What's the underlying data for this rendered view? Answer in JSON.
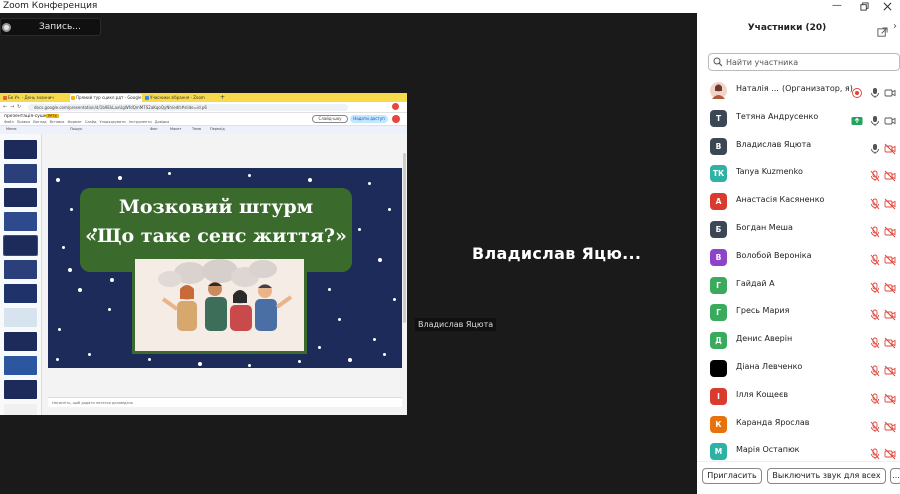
{
  "window": {
    "title": "Zoom Конференция",
    "minimize_label": "—"
  },
  "recording": {
    "label": "Запись..."
  },
  "screenshare": {
    "tabs": [
      {
        "label": "Бе Уч. - День знаннич вардів і",
        "fav": "#e35d3a"
      },
      {
        "label": "Прямий тур сцикл.рдт - Google",
        "fav": "#f4b400"
      },
      {
        "label": "Учасники зібрання - Zoom",
        "fav": "#2d8cff"
      }
    ],
    "url": "docs.google.com/presentation/d/1b9EkLaxUgWfdQmM7S2aKqoQyNh/edit#slide=id.p6",
    "doc_title": "презентація-сушка",
    "doc_badge": "PPTX",
    "menu": "Файл  Правка  Вигляд  Вставка  Формат  Слайд  Упорядкувати  Інструменти  Довідка",
    "slideshow_label": "Слайд-шоу",
    "share_label": "Надати доступ",
    "toolbar_items": [
      "Меню",
      "Пошук",
      "Фон",
      "Макет",
      "Тема",
      "Перехід"
    ],
    "notes_placeholder": "Натисніть, щоб додати нотатки доповідача",
    "slide": {
      "title_line1": "Мозковий штурм",
      "title_line2": "«Що таке сенс життя?»"
    },
    "thumb_colors": [
      "#1c2b5a",
      "#2b3f7a",
      "#1c2b5a",
      "#2f4a8c",
      "#1c2b5a",
      "#2b3f7a",
      "#1f3269",
      "#d8e3f0",
      "#1c2b5a",
      "#2c56a0",
      "#1c2b5a",
      "#f0f0f0"
    ]
  },
  "active_speaker": {
    "display": "Владислав Яцю...",
    "tag": "Владислав Яцюта"
  },
  "participants": {
    "title": "Участники (20)",
    "search_placeholder": "Найти участника",
    "items": [
      {
        "name": "Наталія ...",
        "role": "(Организатор, я)",
        "initials": "",
        "color": "#f2d3c9",
        "photo": true,
        "mic": "on",
        "cam": "on",
        "extra": "record"
      },
      {
        "name": "Тетяна Андрусенко",
        "role": "",
        "initials": "Т",
        "color": "#3b4754",
        "mic": "on",
        "cam": "on",
        "extra": "share"
      },
      {
        "name": "Владислав Яцюта",
        "role": "",
        "initials": "В",
        "color": "#3b4754",
        "mic": "on",
        "cam": "off"
      },
      {
        "name": "Tanya Kuzmenko",
        "role": "",
        "initials": "ТК",
        "color": "#2db3a5",
        "mic": "off",
        "cam": "off"
      },
      {
        "name": "Анастасія Касяненко",
        "role": "",
        "initials": "А",
        "color": "#d93c2e",
        "mic": "off",
        "cam": "off"
      },
      {
        "name": "Богдан Меша",
        "role": "",
        "initials": "Б",
        "color": "#3b4754",
        "mic": "off",
        "cam": "off"
      },
      {
        "name": "Волобой Вероніка",
        "role": "",
        "initials": "В",
        "color": "#8e44c9",
        "mic": "off",
        "cam": "off"
      },
      {
        "name": "Гайдай А",
        "role": "",
        "initials": "Г",
        "color": "#3aaa5c",
        "mic": "off",
        "cam": "off"
      },
      {
        "name": "Гресь Мария",
        "role": "",
        "initials": "Г",
        "color": "#3aaa5c",
        "mic": "off",
        "cam": "off"
      },
      {
        "name": "Денис Аверін",
        "role": "",
        "initials": "Д",
        "color": "#3aaa5c",
        "mic": "off",
        "cam": "off"
      },
      {
        "name": "Діана Левченко",
        "role": "",
        "initials": "",
        "color": "#000000",
        "mic": "off",
        "cam": "off"
      },
      {
        "name": "Ілля Кощеєв",
        "role": "",
        "initials": "І",
        "color": "#d93c2e",
        "mic": "off",
        "cam": "off"
      },
      {
        "name": "Каранда Ярослав",
        "role": "",
        "initials": "К",
        "color": "#e8720c",
        "mic": "off",
        "cam": "off"
      },
      {
        "name": "Марія Остапюк",
        "role": "",
        "initials": "М",
        "color": "#2db3a5",
        "mic": "off",
        "cam": "off"
      }
    ]
  },
  "footer": {
    "invite_label": "Пригласить",
    "mute_all_label": "Выключить звук для всех",
    "more_label": "..."
  }
}
